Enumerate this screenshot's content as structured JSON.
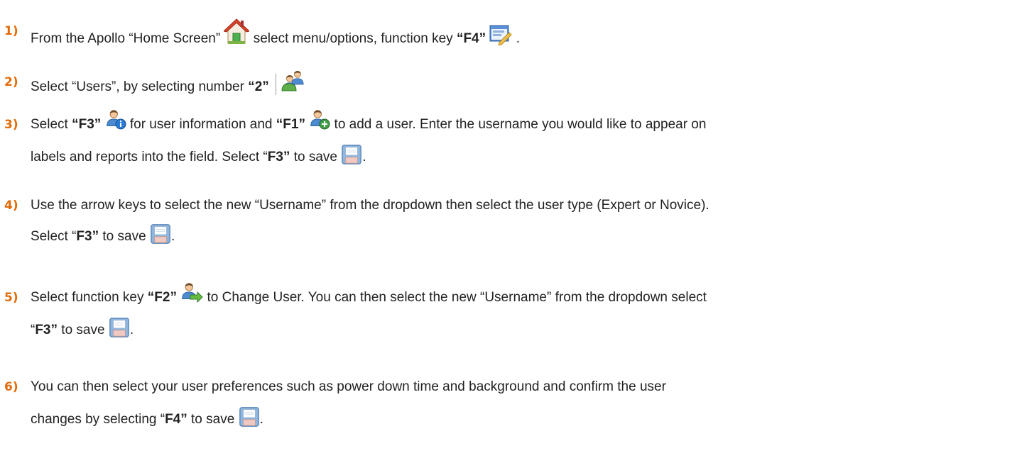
{
  "steps": [
    {
      "number": "1)",
      "lines": [
        [
          "From the Apollo “Home Screen” ",
          " select menu/options, function key ",
          "“F4”",
          " ",
          " ."
        ]
      ]
    },
    {
      "number": "2)",
      "lines": [
        [
          "Select “Users”, by selecting number ",
          "“2”"
        ]
      ]
    },
    {
      "number": "3)",
      "lines": [
        [
          "Select ",
          "“F3”",
          " ",
          " for user information and ",
          "“F1”",
          " ",
          " to add a user. Enter the username you would like to appear on"
        ],
        [
          "labels and reports into the field. Select “",
          "F3”",
          " to save ",
          "."
        ]
      ]
    },
    {
      "number": "4)",
      "lines": [
        [
          "Use the arrow keys to select the new “Username” from the dropdown then select the user type (Expert or Novice)."
        ],
        [
          "Select “",
          "F3”",
          " to save ",
          "."
        ]
      ]
    },
    {
      "number": "5)",
      "lines": [
        [
          "Select function key ",
          "“F2”",
          " ",
          " to Change User. You can then select the new “Username” from the dropdown select"
        ],
        [
          "“",
          "F3”",
          " to save ",
          "."
        ]
      ]
    },
    {
      "number": "6)",
      "lines": [
        [
          "You can then select your user preferences such as power down time and background and confirm the user"
        ],
        [
          "changes by selecting “",
          "F4”",
          " to save ",
          "."
        ]
      ]
    }
  ],
  "icons": {
    "home": "home-icon",
    "menu_options": "menu-options-icon",
    "users": "users-icon",
    "user_info": "user-info-icon",
    "add_user": "add-user-icon",
    "save": "save-icon",
    "change_user": "change-user-icon"
  },
  "colors": {
    "step_number": "#e36c0a",
    "text": "#222222"
  }
}
